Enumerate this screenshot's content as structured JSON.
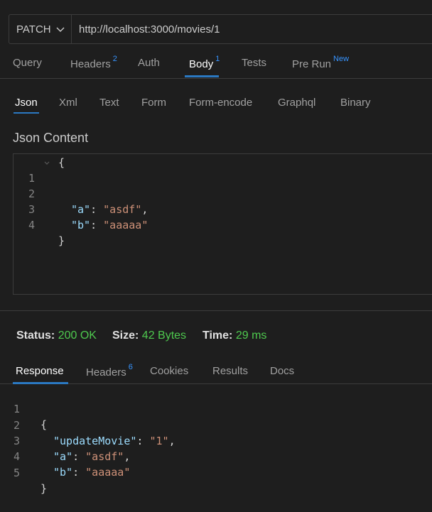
{
  "request": {
    "method": "PATCH",
    "url": "http://localhost:3000/movies/1"
  },
  "request_tabs": [
    {
      "label": "Query",
      "badge": ""
    },
    {
      "label": "Headers",
      "badge": "2"
    },
    {
      "label": "Auth",
      "badge": ""
    },
    {
      "label": "Body",
      "badge": "1"
    },
    {
      "label": "Tests",
      "badge": ""
    },
    {
      "label": "Pre Run",
      "badge": "New"
    }
  ],
  "active_request_tab": "Body",
  "body_tabs": [
    "Json",
    "Xml",
    "Text",
    "Form",
    "Form-encode",
    "Graphql",
    "Binary"
  ],
  "active_body_tab": "Json",
  "json_content_title": "Json Content",
  "request_body_lines": [
    {
      "n": "1",
      "t": "{"
    },
    {
      "n": "2",
      "k": "\"a\"",
      "v": "\"asdf\"",
      "end": ","
    },
    {
      "n": "3",
      "k": "\"b\"",
      "v": "\"aaaaa\"",
      "end": ""
    },
    {
      "n": "4",
      "t": "}"
    }
  ],
  "status": {
    "status_label": "Status:",
    "status_value": "200 OK",
    "size_label": "Size:",
    "size_value": "42 Bytes",
    "time_label": "Time:",
    "time_value": "29 ms"
  },
  "response_tabs": [
    {
      "label": "Response",
      "badge": ""
    },
    {
      "label": "Headers",
      "badge": "6"
    },
    {
      "label": "Cookies",
      "badge": ""
    },
    {
      "label": "Results",
      "badge": ""
    },
    {
      "label": "Docs",
      "badge": ""
    }
  ],
  "active_response_tab": "Response",
  "response_body_lines": [
    {
      "n": "1",
      "t": "{"
    },
    {
      "n": "2",
      "k": "\"updateMovie\"",
      "v": "\"1\"",
      "end": ","
    },
    {
      "n": "3",
      "k": "\"a\"",
      "v": "\"asdf\"",
      "end": ","
    },
    {
      "n": "4",
      "k": "\"b\"",
      "v": "\"aaaaa\"",
      "end": ""
    },
    {
      "n": "5",
      "t": "}"
    }
  ],
  "colors": {
    "accent": "#2b79c2",
    "success": "#4ec94e",
    "json_key": "#9cdcfe",
    "json_string": "#ce9178",
    "badge": "#3794ff"
  }
}
